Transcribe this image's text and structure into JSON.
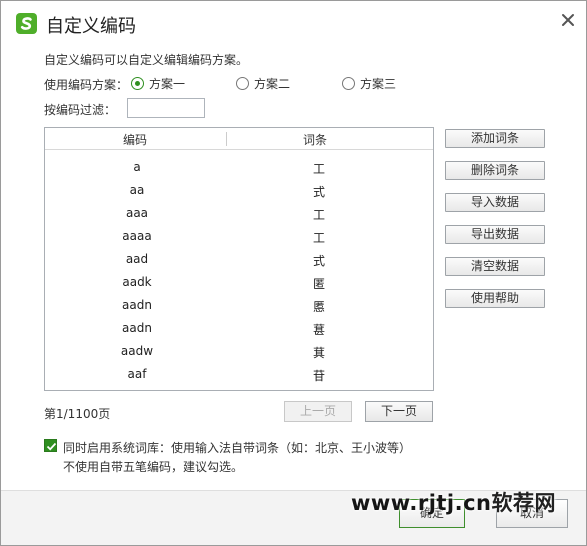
{
  "window": {
    "title": "自定义编码",
    "close_icon": "close-icon",
    "logo_icon": "sogou-s-logo"
  },
  "description": "自定义编码可以自定义编辑编码方案。",
  "scheme": {
    "label": "使用编码方案：",
    "options": [
      "方案一",
      "方案二",
      "方案三"
    ],
    "selected": "方案一",
    "accent": "#2f8f20"
  },
  "filter": {
    "label": "按编码过滤：",
    "value": ""
  },
  "table": {
    "columns": [
      "编码",
      "词条"
    ],
    "rows": [
      {
        "code": "a",
        "word": "工"
      },
      {
        "code": "aa",
        "word": "式"
      },
      {
        "code": "aaa",
        "word": "工"
      },
      {
        "code": "aaaa",
        "word": "工"
      },
      {
        "code": "aad",
        "word": "式"
      },
      {
        "code": "aadk",
        "word": "匿"
      },
      {
        "code": "aadn",
        "word": "慝"
      },
      {
        "code": "aadn",
        "word": "葚"
      },
      {
        "code": "aadw",
        "word": "萁"
      },
      {
        "code": "aaf",
        "word": "苷"
      }
    ]
  },
  "side_buttons": [
    "添加词条",
    "删除词条",
    "导入数据",
    "导出数据",
    "清空数据",
    "使用帮助"
  ],
  "pagination": {
    "info": "第1/1100页",
    "prev": "上一页",
    "next": "下一页"
  },
  "system_lexicon": {
    "checked": true,
    "label": "同时启用系统词库：使用输入法自带词条（如：北京、王小波等）",
    "note": "不使用自带五笔编码，建议勾选。"
  },
  "footer": {
    "ok": "确定",
    "cancel": "取消"
  },
  "watermark": {
    "latin": "www.rjtj.cn",
    "cn": "软荐网"
  }
}
